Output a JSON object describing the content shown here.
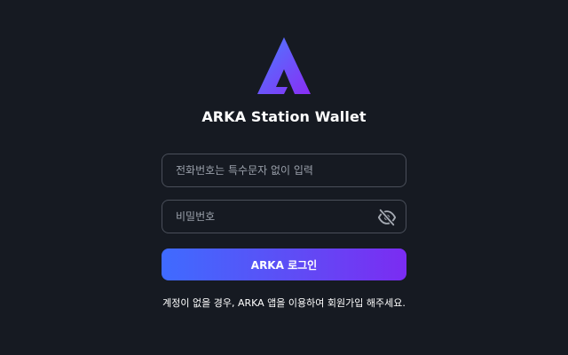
{
  "app": {
    "title": "ARKA Station Wallet",
    "logo_icon": "arka-logo-icon"
  },
  "form": {
    "phone_placeholder": "전화번호는 특수문자 없이 입력",
    "phone_value": "",
    "password_placeholder": "비밀번호",
    "password_value": "",
    "visibility_icon": "eye-off-icon",
    "login_label": "ARKA 로그인"
  },
  "footer": {
    "signup_note": "계정이 없을 경우, ARKA 앱을 이용하여 회원가입 해주세요."
  },
  "colors": {
    "background": "#161a22",
    "field_border": "#4a4f5a",
    "accent_start": "#3f6bff",
    "accent_end": "#7b2cf2"
  }
}
